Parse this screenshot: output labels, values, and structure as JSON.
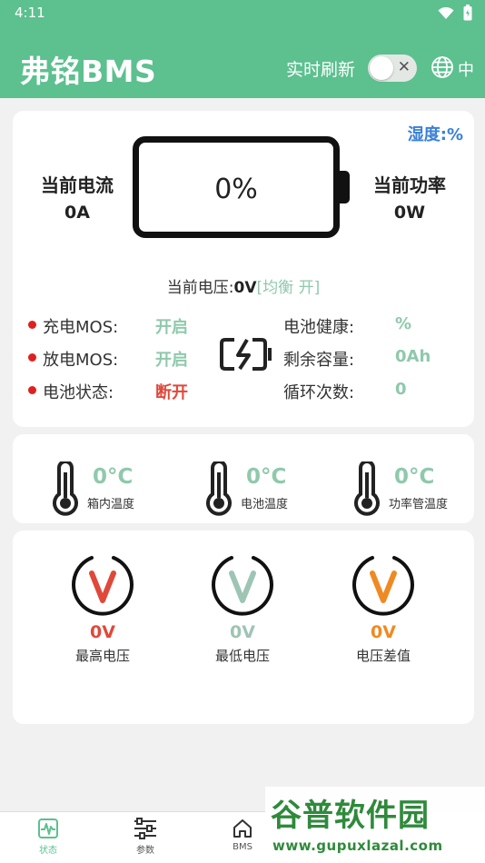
{
  "status_bar": {
    "time": "4:11"
  },
  "app_bar": {
    "title": "弗铭BMS",
    "realtime_label": "实时刷新",
    "lang": "中"
  },
  "battery_card": {
    "humidity": "湿度:%",
    "current_label": "当前电流",
    "current_value": "0A",
    "power_label": "当前功率",
    "power_value": "0W",
    "percent": "0%",
    "voltage_label": "当前电压:",
    "voltage_value": "0V",
    "balance": "[均衡 开]",
    "rows_left": [
      {
        "label": "充电MOS:",
        "value": "开启"
      },
      {
        "label": "放电MOS:",
        "value": "开启"
      },
      {
        "label": "电池状态:",
        "value": "断开"
      }
    ],
    "rows_right": [
      {
        "label": "电池健康:",
        "value": "%"
      },
      {
        "label": "剩余容量:",
        "value": "0Ah"
      },
      {
        "label": "循环次数:",
        "value": "0"
      }
    ]
  },
  "temperatures": [
    {
      "value": "0°C",
      "label": "箱内温度"
    },
    {
      "value": "0°C",
      "label": "电池温度"
    },
    {
      "value": "0°C",
      "label": "功率管温度"
    }
  ],
  "voltages": [
    {
      "value": "0V",
      "label": "最高电压",
      "color": "#e0483a"
    },
    {
      "value": "0V",
      "label": "最低电压",
      "color": "#9ec4b4"
    },
    {
      "value": "0V",
      "label": "电压差值",
      "color": "#ef8a22"
    }
  ],
  "tabs": [
    {
      "label": "状态"
    },
    {
      "label": "参数"
    },
    {
      "label": "BMS"
    }
  ],
  "watermark": {
    "line1": "谷普软件园",
    "line2": "www.gupuxlazal.com"
  },
  "colors": {
    "primary": "#5cc08f",
    "accent_green": "#8fc9ac",
    "red": "#e0483a",
    "blue": "#3a80d8"
  }
}
